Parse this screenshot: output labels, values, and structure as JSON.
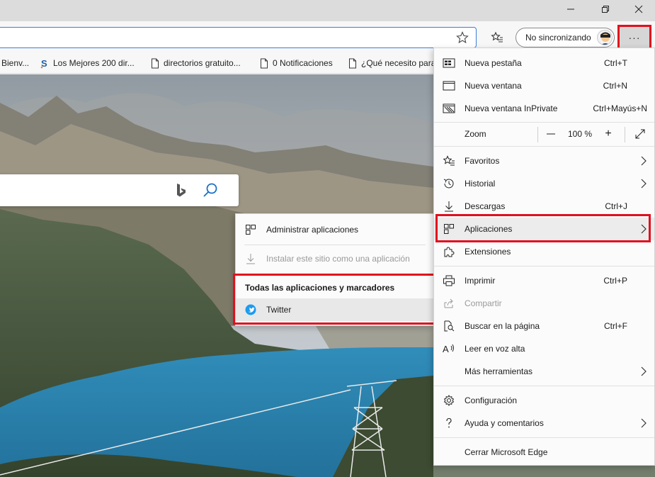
{
  "window": {
    "controls": {
      "minimize_icon": "minimize-icon",
      "restore_icon": "restore-icon",
      "close_icon": "close-icon"
    }
  },
  "toolbar": {
    "profile_label": "No sincronizando",
    "more_label": "···",
    "accent_color": "#e0101e"
  },
  "bookmarks": [
    {
      "label": "Bienv...",
      "icon": "page-icon"
    },
    {
      "label": "Los Mejores 200 dir...",
      "icon": "s-icon"
    },
    {
      "label": "directorios gratuito...",
      "icon": "page-icon"
    },
    {
      "label": "0 Notificaciones",
      "icon": "page-icon"
    },
    {
      "label": "¿Qué necesito para",
      "icon": "page-icon"
    }
  ],
  "menu": {
    "new_tab": {
      "label": "Nueva pestaña",
      "shortcut": "Ctrl+T"
    },
    "new_window": {
      "label": "Nueva ventana",
      "shortcut": "Ctrl+N"
    },
    "new_inprivate": {
      "label": "Nueva ventana InPrivate",
      "shortcut": "Ctrl+Mayús+N"
    },
    "zoom": {
      "label": "Zoom",
      "minus": "—",
      "value": "100 %",
      "plus": "+"
    },
    "favorites": {
      "label": "Favoritos"
    },
    "history": {
      "label": "Historial"
    },
    "downloads": {
      "label": "Descargas",
      "shortcut": "Ctrl+J"
    },
    "apps": {
      "label": "Aplicaciones"
    },
    "extensions": {
      "label": "Extensiones"
    },
    "print": {
      "label": "Imprimir",
      "shortcut": "Ctrl+P"
    },
    "share": {
      "label": "Compartir"
    },
    "find": {
      "label": "Buscar en la página",
      "shortcut": "Ctrl+F"
    },
    "read_aloud": {
      "label": "Leer en voz alta"
    },
    "more_tools": {
      "label": "Más herramientas"
    },
    "settings": {
      "label": "Configuración"
    },
    "help": {
      "label": "Ayuda y comentarios"
    },
    "close_edge": {
      "label": "Cerrar Microsoft Edge"
    }
  },
  "submenu": {
    "manage_apps": {
      "label": "Administrar aplicaciones"
    },
    "install_site": {
      "label": "Instalar este sitio como una aplicación"
    },
    "section_title": "Todas las aplicaciones y marcadores",
    "twitter": {
      "label": "Twitter"
    }
  }
}
